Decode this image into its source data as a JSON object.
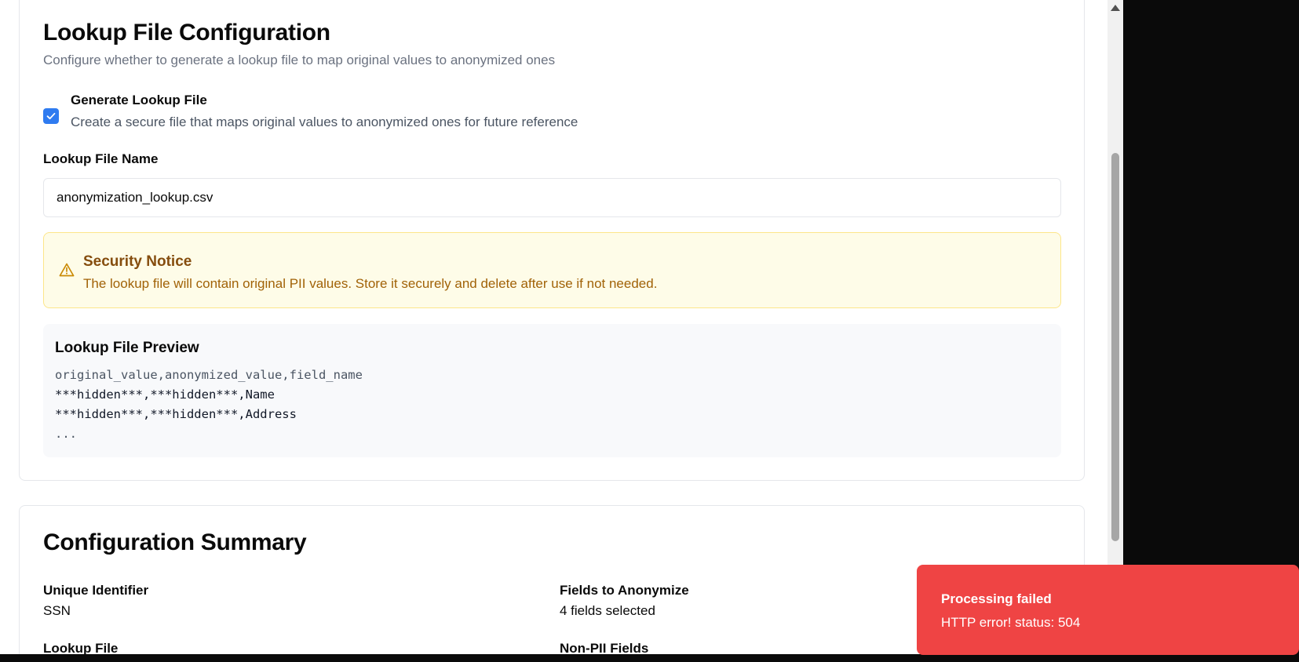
{
  "lookup_config": {
    "title": "Lookup File Configuration",
    "subtitle": "Configure whether to generate a lookup file to map original values to anonymized ones",
    "generate": {
      "checked": true,
      "label": "Generate Lookup File",
      "description": "Create a secure file that maps original values to anonymized ones for future reference"
    },
    "file_name_label": "Lookup File Name",
    "file_name_value": "anonymization_lookup.csv",
    "security_notice": {
      "icon": "warning-triangle-icon",
      "title": "Security Notice",
      "text": "The lookup file will contain original PII values. Store it securely and delete after use if not needed."
    },
    "preview": {
      "title": "Lookup File Preview",
      "lines": [
        "original_value,anonymized_value,field_name",
        "***hidden***,***hidden***,Name",
        "***hidden***,***hidden***,Address",
        "..."
      ]
    }
  },
  "summary": {
    "title": "Configuration Summary",
    "items": [
      {
        "label": "Unique Identifier",
        "value": "SSN"
      },
      {
        "label": "Fields to Anonymize",
        "value": "4 fields selected"
      },
      {
        "label": "Lookup File",
        "value": ""
      },
      {
        "label": "Non-PII Fields",
        "value": ""
      }
    ]
  },
  "toast": {
    "title": "Processing failed",
    "message": "HTTP error! status: 504",
    "color": "#ef4444"
  },
  "colors": {
    "accent": "#2f7bf0",
    "notice_bg": "#fefce8",
    "notice_title": "#854d0e",
    "notice_text": "#a16207"
  }
}
